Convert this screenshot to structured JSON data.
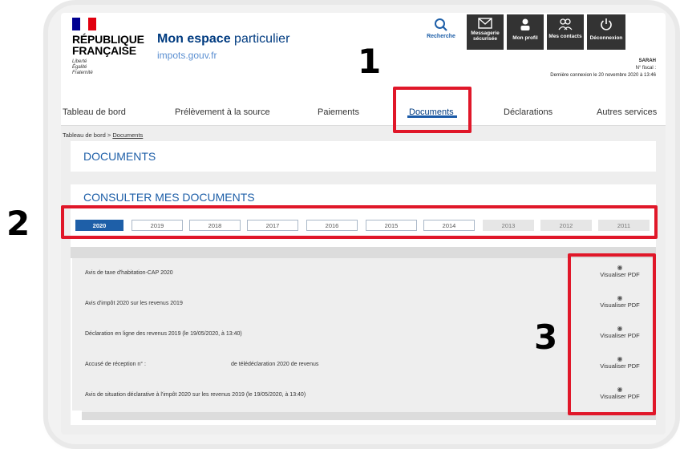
{
  "header": {
    "republic_name_line1": "RÉPUBLIQUE",
    "republic_name_line2": "FRANÇAISE",
    "motto": [
      "Liberté",
      "Égalité",
      "Fraternité"
    ],
    "brand_title_bold": "Mon espace",
    "brand_title_rest": " particulier",
    "brand_sub": "impots.gouv.fr",
    "buttons": {
      "search": "Recherche",
      "messaging": "Messagerie sécurisée",
      "profile": "Mon profil",
      "contacts": "Mes contacts",
      "logout": "Déconnexion"
    },
    "user_name": "SARAH",
    "fiscal_no": "N° fiscal :",
    "last_login": "Dernière connexion le 20 novembre 2020 à 13:46"
  },
  "nav": {
    "items": [
      "Tableau de bord",
      "Prélèvement à la source",
      "Paiements",
      "Documents",
      "Déclarations",
      "Autres services"
    ],
    "active": "Documents"
  },
  "breadcrumb": {
    "home": "Tableau de bord",
    "sep": ">",
    "current": "Documents"
  },
  "page_title": "DOCUMENTS",
  "section_title": "CONSULTER MES DOCUMENTS",
  "years": {
    "active": "2020",
    "enabled": [
      "2019",
      "2018",
      "2017",
      "2016",
      "2015",
      "2014"
    ],
    "disabled": [
      "2013",
      "2012",
      "2011"
    ]
  },
  "documents": [
    "Avis de taxe d'habitation-CAP 2020",
    "Avis d'impôt 2020 sur les revenus 2019",
    "Déclaration en ligne des revenus 2019 (le 19/05/2020, à 13:40)",
    "Accusé de réception n° :",
    "Avis de situation déclarative à l'impôt 2020 sur les revenus 2019 (le 19/05/2020, à 13:40)"
  ],
  "doc4_suffix": "de télédéclaration 2020 de revenus",
  "doc_action": "Visualiser PDF",
  "callouts": [
    "1",
    "2",
    "3"
  ],
  "colors": {
    "brand_blue": "#003b80",
    "link_blue": "#1e5fa8",
    "highlight_red": "#e01729",
    "flag_blue": "#000091",
    "flag_red": "#e1000f"
  }
}
